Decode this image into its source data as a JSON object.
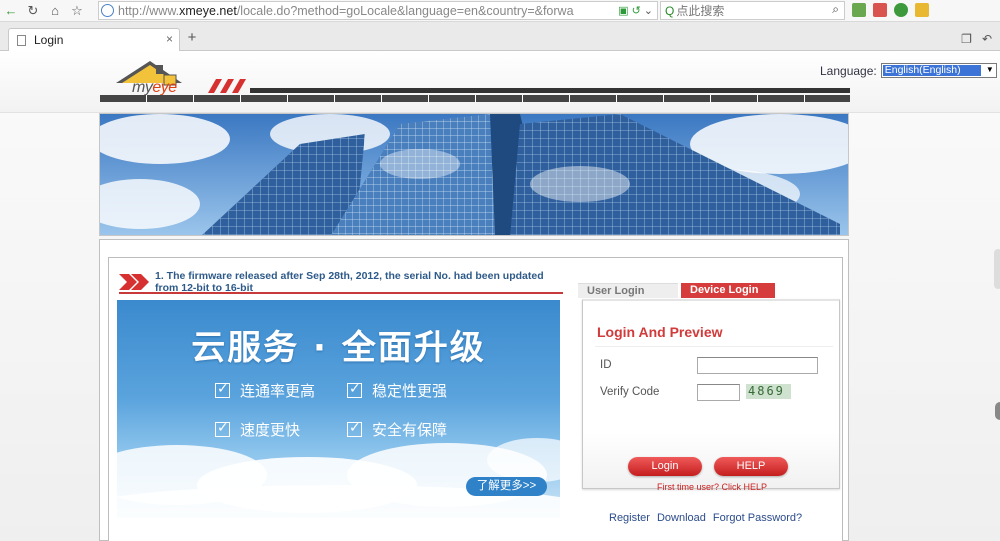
{
  "browser": {
    "url_prefix": "http://www.",
    "url_domain": "xmeye.net",
    "url_rest": "/locale.do?method=goLocale&language=en&country=&forwa",
    "search_placeholder": "点此搜索",
    "tab_title": "Login",
    "tab_close": "×",
    "tab_add": "+"
  },
  "header": {
    "logo_my": "my",
    "logo_eye": "eye",
    "language_label": "Language:",
    "language_selected": "English(English)"
  },
  "notice": {
    "text": "1. The firmware released after Sep 28th, 2012, the serial No. had been updated from 12-bit to 16-bit"
  },
  "promo": {
    "title": "云服务 · 全面升级",
    "items": [
      "连通率更高",
      "稳定性更强",
      "速度更快",
      "安全有保障"
    ],
    "more": "了解更多>>"
  },
  "login": {
    "tab_user": "User Login",
    "tab_device": "Device Login",
    "title": "Login And Preview",
    "id_label": "ID",
    "verify_label": "Verify Code",
    "captcha": "4869",
    "login_button": "Login",
    "help_button": "HELP",
    "first_time": "First time user? Click HELP"
  },
  "links": {
    "register": "Register",
    "download": "Download",
    "forgot": "Forgot Password?"
  }
}
